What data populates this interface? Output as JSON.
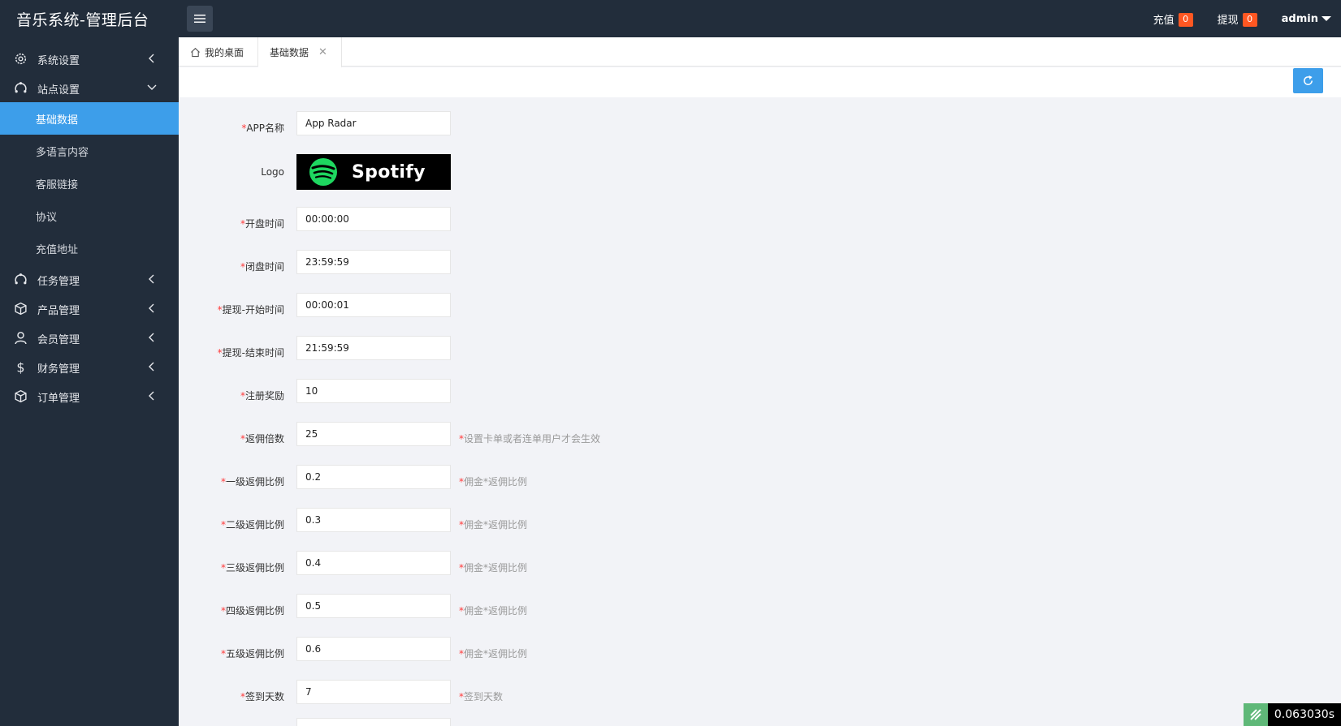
{
  "header": {
    "brand": "音乐系统-管理后台",
    "recharge_label": "充值",
    "recharge_count": "0",
    "withdraw_label": "提现",
    "withdraw_count": "0",
    "user": "admin",
    "badge_color": "#ff5722"
  },
  "sidebar": {
    "items": [
      {
        "label": "系统设置",
        "icon": "gear-icon",
        "state": "collapsed"
      },
      {
        "label": "站点设置",
        "icon": "site-icon",
        "state": "expanded",
        "children": [
          "基础数据",
          "多语言内容",
          "客服链接",
          "协议",
          "充值地址"
        ],
        "active_child": "基础数据"
      },
      {
        "label": "任务管理",
        "icon": "task-icon",
        "state": "collapsed"
      },
      {
        "label": "产品管理",
        "icon": "cube-icon",
        "state": "collapsed"
      },
      {
        "label": "会员管理",
        "icon": "user-icon",
        "state": "collapsed"
      },
      {
        "label": "财务管理",
        "icon": "dollar-icon",
        "state": "collapsed"
      },
      {
        "label": "订单管理",
        "icon": "order-icon",
        "state": "collapsed"
      }
    ],
    "active_color": "#3d9eea"
  },
  "tabs": {
    "home": "我的桌面",
    "current": "基础数据",
    "close": "✕"
  },
  "form": {
    "required_mark": "*",
    "fields": [
      {
        "label": "APP名称",
        "required": true,
        "value": "App Radar",
        "hint": ""
      },
      {
        "label": "Logo",
        "required": false,
        "logo_text": "Spotify"
      },
      {
        "label": "开盘时间",
        "required": true,
        "value": "00:00:00",
        "hint": ""
      },
      {
        "label": "闭盘时间",
        "required": true,
        "value": "23:59:59",
        "hint": ""
      },
      {
        "label": "提现-开始时间",
        "required": true,
        "value": "00:00:01",
        "hint": ""
      },
      {
        "label": "提现-结束时间",
        "required": true,
        "value": "21:59:59",
        "hint": ""
      },
      {
        "label": "注册奖励",
        "required": true,
        "value": "10",
        "hint": ""
      },
      {
        "label": "返佣倍数",
        "required": true,
        "value": "25",
        "hint": "设置卡单或者连单用户才会生效"
      },
      {
        "label": "一级返佣比例",
        "required": true,
        "value": "0.2",
        "hint": "佣金*返佣比例"
      },
      {
        "label": "二级返佣比例",
        "required": true,
        "value": "0.3",
        "hint": "佣金*返佣比例"
      },
      {
        "label": "三级返佣比例",
        "required": true,
        "value": "0.4",
        "hint": "佣金*返佣比例"
      },
      {
        "label": "四级返佣比例",
        "required": true,
        "value": "0.5",
        "hint": "佣金*返佣比例"
      },
      {
        "label": "五级返佣比例",
        "required": true,
        "value": "0.6",
        "hint": "佣金*返佣比例"
      },
      {
        "label": "签到天数",
        "required": true,
        "value": "7",
        "hint": "签到天数"
      }
    ]
  },
  "timer": {
    "value": "0.063030s"
  }
}
